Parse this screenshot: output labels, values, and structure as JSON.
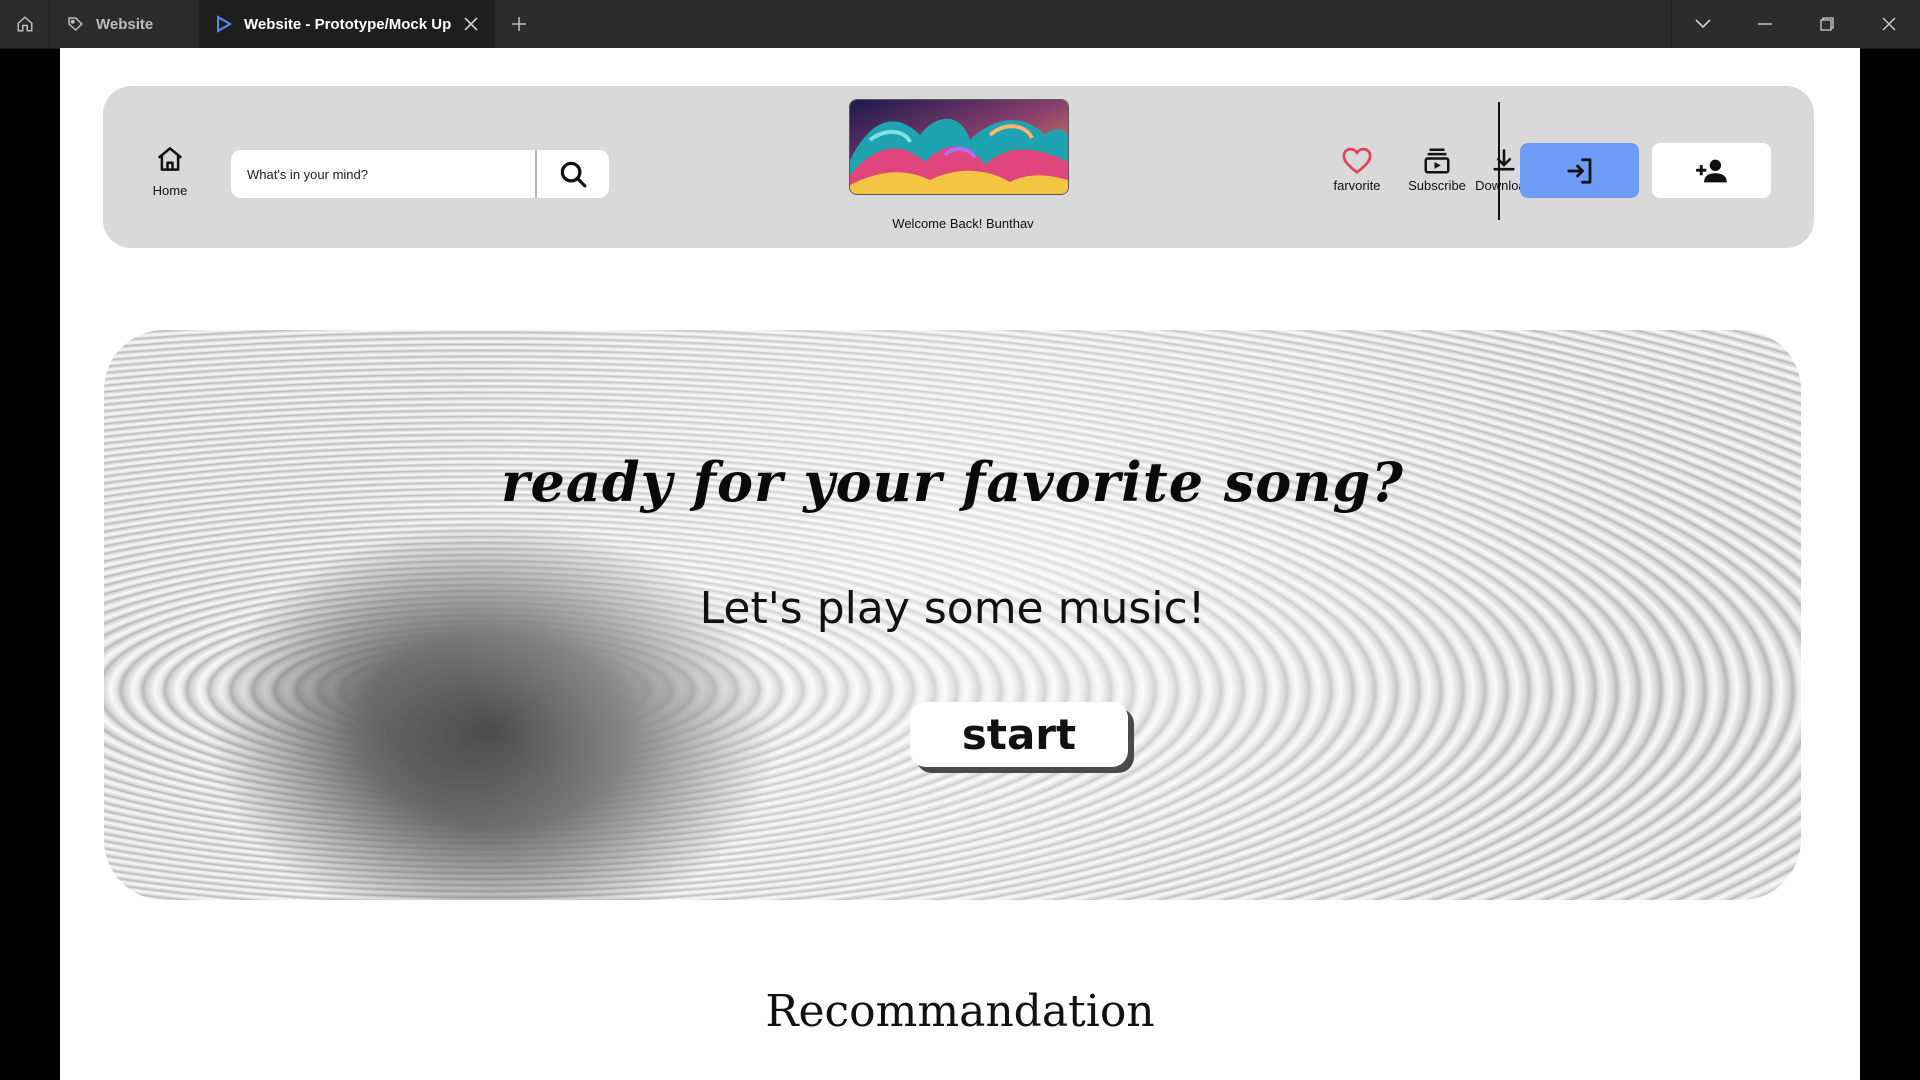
{
  "tabs": [
    {
      "label": "Website"
    },
    {
      "label": "Website - Prototype/Mock Up"
    }
  ],
  "header": {
    "home_label": "Home",
    "search_placeholder": "What's in your mind?",
    "welcome": "Welcome Back! Bunthav",
    "nav": {
      "favorite": "farvorite",
      "subscribe": "Subscribe",
      "download": "Download"
    }
  },
  "hero": {
    "title": "ready for your favorite song?",
    "subtitle": "Let's play some music!",
    "start_label": "start"
  },
  "sections": {
    "recommendation": "Recommandation"
  },
  "colors": {
    "login_button": "#6e9bf8",
    "favorite_icon": "#e3425a",
    "header_bg": "#d9d9d9"
  },
  "icons": {
    "home": "home-icon",
    "search": "search-icon",
    "favorite": "heart-icon",
    "subscribe": "subscriptions-icon",
    "download": "download-icon",
    "login": "login-icon",
    "signup": "person-add-icon"
  }
}
